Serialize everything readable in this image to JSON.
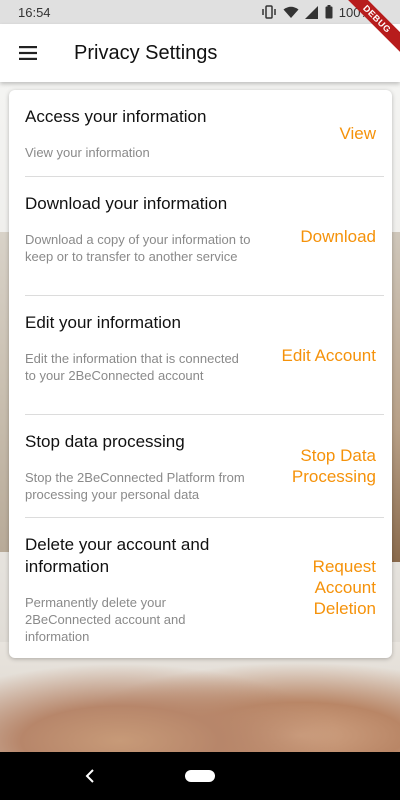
{
  "status_bar": {
    "time": "16:54",
    "battery": "100%",
    "icons": [
      "vibrate-icon",
      "wifi-icon",
      "signal-icon",
      "battery-icon"
    ]
  },
  "debug_banner": "DEBUG",
  "app_bar": {
    "menu_icon": "hamburger-menu-icon",
    "title": "Privacy Settings"
  },
  "colors": {
    "accent": "#f5920a",
    "title": "#111111",
    "description": "#8a8a8a"
  },
  "sections": [
    {
      "title": "Access your information",
      "description": "View your information",
      "action": "View"
    },
    {
      "title": "Download your information",
      "description": "Download a copy of your information to keep or to transfer to another service",
      "action": "Download"
    },
    {
      "title": "Edit your information",
      "description": "Edit the information that is connected to your 2BeConnected account",
      "action": "Edit Account"
    },
    {
      "title": "Stop data processing",
      "description": "Stop the 2BeConnected Platform from processing your personal data",
      "action": "Stop Data Processing"
    },
    {
      "title": "Delete your account and information",
      "description": "Permanently delete your 2BeConnected account and information",
      "action": "Request Account Deletion"
    }
  ],
  "nav_bar": {
    "back_icon": "back-icon",
    "home_icon": "home-pill-icon"
  }
}
